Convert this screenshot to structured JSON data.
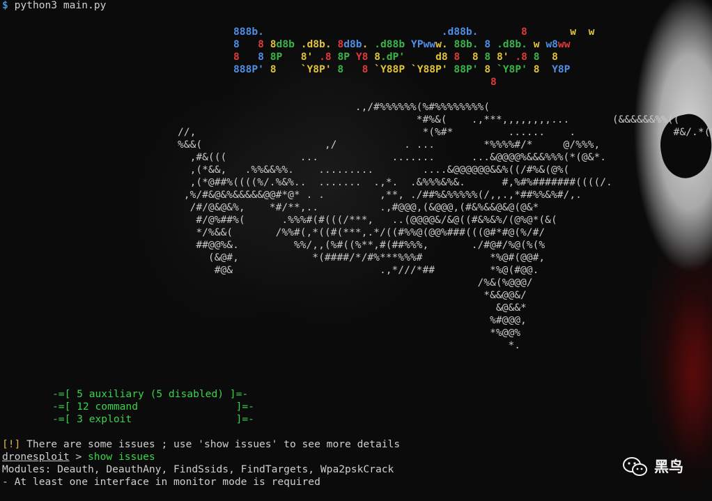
{
  "command": {
    "prompt": "$",
    "text": "python3 main.py"
  },
  "banner": {
    "lines": [
      [
        [
          "888b.",
          "#4f8fe6"
        ],
        [
          "                             ",
          "#fff"
        ],
        [
          ".d88b.",
          "#4f8fe6"
        ],
        [
          "       ",
          "#fff"
        ],
        [
          "8",
          "#e03a3a"
        ],
        [
          "       ",
          "#fff"
        ],
        [
          "w",
          "#e0c43a"
        ],
        [
          "  ",
          "#fff"
        ],
        [
          "w",
          "#e0c43a"
        ]
      ],
      [
        [
          "8",
          "#4f8fe6"
        ],
        [
          "   ",
          "#fff"
        ],
        [
          "8",
          "#e03a3a"
        ],
        [
          " ",
          "#fff"
        ],
        [
          "8",
          "#e0c43a"
        ],
        [
          "d8b",
          "#3ab54a"
        ],
        [
          " ",
          "#fff"
        ],
        [
          ".d8b.",
          "#e0c43a"
        ],
        [
          " ",
          "#fff"
        ],
        [
          "8",
          "#e03a3a"
        ],
        [
          "d8b",
          "#4f8fe6"
        ],
        [
          ".",
          "#e0c43a"
        ],
        [
          " ",
          "#fff"
        ],
        [
          ".d88b",
          "#3ab54a"
        ],
        [
          " ",
          "#fff"
        ],
        [
          "YPww",
          "#4f8fe6"
        ],
        [
          "w.",
          "#e0c43a"
        ],
        [
          " ",
          "#fff"
        ],
        [
          "88b.",
          "#3ab54a"
        ],
        [
          " ",
          "#fff"
        ],
        [
          "8",
          "#4f8fe6"
        ],
        [
          " ",
          "#fff"
        ],
        [
          ".d8b.",
          "#3ab54a"
        ],
        [
          " ",
          "#fff"
        ],
        [
          "w",
          "#e0c43a"
        ],
        [
          " ",
          "#fff"
        ],
        [
          "w8",
          "#4f8fe6"
        ],
        [
          "ww",
          "#e03a3a"
        ]
      ],
      [
        [
          "8",
          "#e03a3a"
        ],
        [
          "   ",
          "#fff"
        ],
        [
          "8",
          "#4f8fe6"
        ],
        [
          " ",
          "#fff"
        ],
        [
          "8P",
          "#3ab54a"
        ],
        [
          "   ",
          "#fff"
        ],
        [
          "8'",
          "#e0c43a"
        ],
        [
          " ",
          "#fff"
        ],
        [
          ".8",
          "#e03a3a"
        ],
        [
          " ",
          "#fff"
        ],
        [
          "8P",
          "#3ab54a"
        ],
        [
          " ",
          "#fff"
        ],
        [
          "Y8",
          "#e03a3a"
        ],
        [
          " ",
          "#fff"
        ],
        [
          "8",
          "#e0c43a"
        ],
        [
          ".dP'",
          "#3ab54a"
        ],
        [
          "     ",
          "#fff"
        ],
        [
          "d8",
          "#e0c43a"
        ],
        [
          " ",
          "#fff"
        ],
        [
          "8",
          "#e03a3a"
        ],
        [
          "  ",
          "#fff"
        ],
        [
          "8",
          "#e0c43a"
        ],
        [
          " ",
          "#fff"
        ],
        [
          "8",
          "#3ab54a"
        ],
        [
          " ",
          "#fff"
        ],
        [
          "8'",
          "#e0c43a"
        ],
        [
          " ",
          "#fff"
        ],
        [
          ".8",
          "#e03a3a"
        ],
        [
          " ",
          "#fff"
        ],
        [
          "8",
          "#3ab54a"
        ],
        [
          "  ",
          "#fff"
        ],
        [
          "8",
          "#e0c43a"
        ]
      ],
      [
        [
          "888P'",
          "#4f8fe6"
        ],
        [
          " ",
          "#fff"
        ],
        [
          "8",
          "#e0c43a"
        ],
        [
          "    ",
          "#fff"
        ],
        [
          "`Y8P'",
          "#e0c43a"
        ],
        [
          " ",
          "#fff"
        ],
        [
          "8",
          "#3ab54a"
        ],
        [
          "   ",
          "#fff"
        ],
        [
          "8",
          "#e03a3a"
        ],
        [
          " ",
          "#fff"
        ],
        [
          "`Y88P",
          "#e0c43a"
        ],
        [
          " ",
          "#fff"
        ],
        [
          "`Y88P'",
          "#e0c43a"
        ],
        [
          " ",
          "#fff"
        ],
        [
          "88P'",
          "#3ab54a"
        ],
        [
          " ",
          "#fff"
        ],
        [
          "8",
          "#e0c43a"
        ],
        [
          " ",
          "#fff"
        ],
        [
          "`Y8P'",
          "#3ab54a"
        ],
        [
          " ",
          "#fff"
        ],
        [
          "8",
          "#e0c43a"
        ],
        [
          "  ",
          "#fff"
        ],
        [
          "Y8P",
          "#4f8fe6"
        ]
      ],
      [
        [
          "                                          ",
          "#fff"
        ],
        [
          "8",
          "#e03a3a"
        ]
      ]
    ]
  },
  "art": [
    "                             .,/#%%%%%%(%#%%%%%%%%(",
    "                                       *#%&(    .,***,,,,,,,,...       (&&&&&&%%((",
    "//,                                     *(%#*         ......    .                #&/.*(%%(/,.",
    "%&&(                    ,/           . ...        *%%%%#/*     @/%%%,",
    "  ,#&(((            ...            .......      ...&@@@@%&&&%%%(*(@&*.",
    "  ,(*&&,   .%%&&%%.    .........        ....&@@@@@@&&%((/#%&(@%(",
    "  ,(*@##%((((%/.%&%..  .......  .,*.  .&%%%&%&.      #,%#%#######((((/.",
    " ,%/#&@&%&&&&&@@#*@* . .         ,**, ./##%&%%%%%(/,,.,*##%%&%#/,.",
    "  /#/@&@&%,    *#/**,..          .,#@@@,(&@@@,(#&%&&@&@(@&*",
    "   #/@%##%(      .%%%#(#(((/***,   ..(@@@@&/&@((#&%&%/(@%@*(&(",
    "   */%&&(       /%%#(,*((#(***,.*/((#%%@(@@%###(((@#*#@(%/#/",
    "   ##@@%&.         %%/,,(%#((%**,#(##%%%,       ./#@#/%@(%(%",
    "     (&@#,            *(####/*/#%***%%%#           *%@#(@@#,",
    "      #@&                        .,*///*##         *%@(#@@.",
    "                                                 /%&(%@@@/",
    "                                                  *&&@@&/",
    "                                                    &@&&*",
    "                                                   %#@@@,",
    "                                                   *%@@%",
    "                                                      *."
  ],
  "modules": [
    "-=[ 5 auxiliary (5 disabled) ]=-",
    "-=[ 12 command                ]=-",
    "-=[ 3 exploit                 ]=-"
  ],
  "issues": {
    "tag": "[!]",
    "message": " There are some issues ; use 'show issues' to see more details",
    "prompt_name": "dronesploit",
    "prompt_sep": " > ",
    "input": "show issues",
    "modules_line": "Modules: Deauth, DeauthAny, FindSsids, FindTargets, Wpa2pskCrack",
    "requirement": "- At least one interface in monitor mode is required"
  },
  "watermark": {
    "icon": "wechat-icon",
    "text": "黑鸟"
  }
}
